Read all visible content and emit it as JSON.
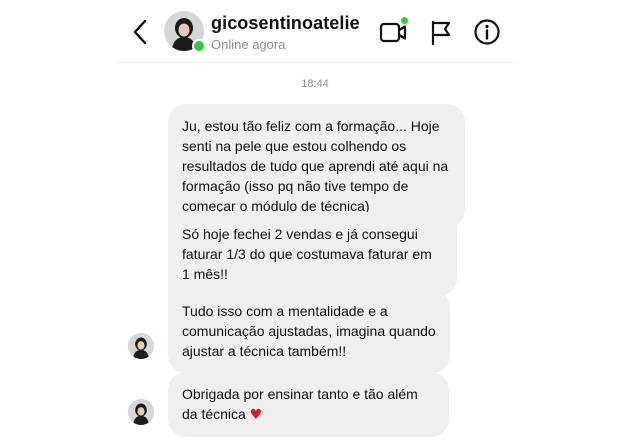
{
  "header": {
    "username": "gicosentinoatelie",
    "status": "Online agora"
  },
  "chat": {
    "timestamp": "18:44",
    "messages": [
      {
        "text": "Ju, estou tão feliz com a formação... Hoje senti na pele que estou colhendo os resultados de tudo que aprendi até aqui na formação (isso pq não tive tempo de começar o módulo de técnica)"
      },
      {
        "text": "Só hoje fechei 2 vendas e já consegui faturar 1/3 do que costumava faturar em 1 mês!!"
      },
      {
        "text": "Tudo isso com a mentalidade e a comunicação ajustadas, imagina quando ajustar a técnica também!!"
      },
      {
        "text": "Obrigada por ensinar tanto e tão além da técnica",
        "emoji": "♥"
      }
    ]
  },
  "colors": {
    "online": "#2ecc3b",
    "bubble": "#efefef",
    "heart": "#e0162b"
  }
}
